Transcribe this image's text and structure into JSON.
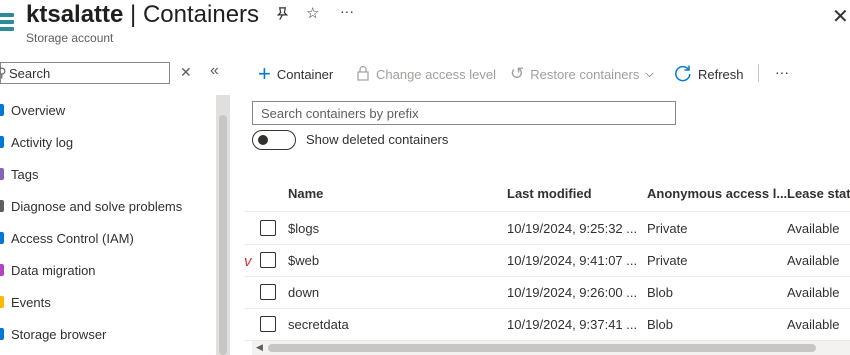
{
  "header": {
    "resource_name": "ktsalatte",
    "separator": " | ",
    "blade_title": "Containers",
    "subtitle": "Storage account",
    "pin_icon": "pin-icon",
    "star_icon": "star-icon",
    "more_icon": "more-icon",
    "close_icon": "close-icon"
  },
  "sidebar": {
    "search_placeholder": "Search",
    "items": [
      {
        "label": "Overview",
        "icon_color": "#0078d4"
      },
      {
        "label": "Activity log",
        "icon_color": "#0078d4"
      },
      {
        "label": "Tags",
        "icon_color": "#8764b8"
      },
      {
        "label": "Diagnose and solve problems",
        "icon_color": "#605e5c"
      },
      {
        "label": "Access Control (IAM)",
        "icon_color": "#0078d4"
      },
      {
        "label": "Data migration",
        "icon_color": "#b146c2"
      },
      {
        "label": "Events",
        "icon_color": "#ffb900"
      },
      {
        "label": "Storage browser",
        "icon_color": "#0078d4"
      }
    ]
  },
  "toolbar": {
    "add_container": "Container",
    "change_access": "Change access level",
    "restore": "Restore containers",
    "refresh": "Refresh",
    "accent": "#0078d4"
  },
  "filter": {
    "placeholder": "Search containers by prefix",
    "show_deleted": "Show deleted containers"
  },
  "table": {
    "columns": [
      "Name",
      "Last modified",
      "Anonymous access l...",
      "Lease state"
    ],
    "rows": [
      {
        "name": "$logs",
        "modified": "10/19/2024, 9:25:32 ...",
        "access": "Private",
        "lease": "Available"
      },
      {
        "name": "$web",
        "modified": "10/19/2024, 9:41:07 ...",
        "access": "Private",
        "lease": "Available"
      },
      {
        "name": "down",
        "modified": "10/19/2024, 9:26:00 ...",
        "access": "Blob",
        "lease": "Available"
      },
      {
        "name": "secretdata",
        "modified": "10/19/2024, 9:37:41 ...",
        "access": "Blob",
        "lease": "Available"
      }
    ]
  },
  "annotation": {
    "mark": "v",
    "color": "#d13438"
  }
}
